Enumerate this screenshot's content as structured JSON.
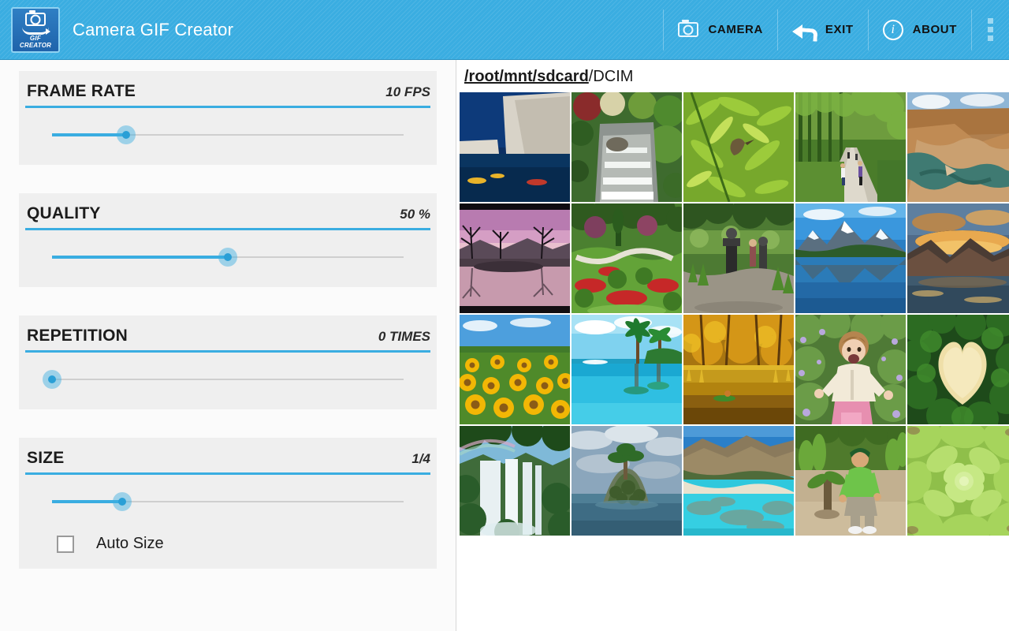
{
  "app": {
    "title": "Camera GIF Creator",
    "icon_name": "gif-creator-app-icon",
    "icon_text_top": "GIF",
    "icon_text_bottom": "CREATOR",
    "header_color": "#3aade1"
  },
  "header": {
    "actions": [
      {
        "label": "CAMERA",
        "icon": "camera-icon"
      },
      {
        "label": "EXIT",
        "icon": "back-arrow-icon"
      },
      {
        "label": "ABOUT",
        "icon": "info-icon"
      }
    ],
    "overflow_icon": "overflow-menu-icon"
  },
  "settings": [
    {
      "id": "frame-rate",
      "title": "FRAME RATE",
      "value": "10 FPS",
      "slider_percent": 21
    },
    {
      "id": "quality",
      "title": "QUALITY",
      "value": "50 %",
      "slider_percent": 50
    },
    {
      "id": "repetition",
      "title": "REPETITION",
      "value": "0 TIMES",
      "slider_percent": 0
    },
    {
      "id": "size",
      "title": "SIZE",
      "value": "1/4",
      "slider_percent": 20
    }
  ],
  "auto_size": {
    "label": "Auto Size",
    "checked": false
  },
  "browser": {
    "path_link": "/root/mnt/sdcard",
    "path_current": "/DCIM",
    "thumbnails": [
      {
        "name": "canyon-kayaks"
      },
      {
        "name": "garden-waterfall"
      },
      {
        "name": "green-leaves-bird"
      },
      {
        "name": "forest-bike-path"
      },
      {
        "name": "desert-canyon-river"
      },
      {
        "name": "pink-sunset-lake"
      },
      {
        "name": "flower-garden-path"
      },
      {
        "name": "botanical-garden-statue"
      },
      {
        "name": "snow-mountain-lake"
      },
      {
        "name": "orange-sunset-rocks"
      },
      {
        "name": "sunflower-field"
      },
      {
        "name": "tropical-palm-lagoon"
      },
      {
        "name": "autumn-golden-river"
      },
      {
        "name": "child-in-flowers"
      },
      {
        "name": "heart-shaped-clearing"
      },
      {
        "name": "rainbow-waterfall"
      },
      {
        "name": "lone-island-tree"
      },
      {
        "name": "turquoise-reef-bay"
      },
      {
        "name": "man-planting-tree"
      },
      {
        "name": "green-succulent"
      }
    ]
  }
}
